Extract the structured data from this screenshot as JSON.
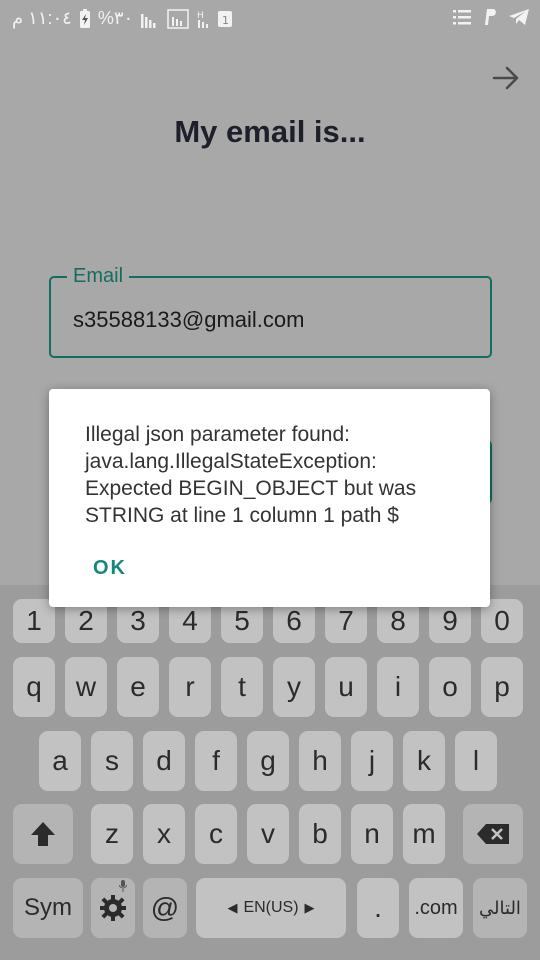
{
  "status_bar": {
    "time": "١١:٠٤ م",
    "battery": "%٣٠",
    "left_icons": [
      "battery-icon",
      "signal-icon",
      "signal-box-icon",
      "hplus-icon",
      "sim-icon"
    ],
    "sim_label": "1",
    "right_icons": [
      "list-icon",
      "paypal-icon",
      "telegram-icon"
    ]
  },
  "page": {
    "title": "My email is...",
    "email_label": "Email",
    "email_value": "s35588133@gmail.com"
  },
  "dialog": {
    "message": "Illegal json parameter found: java.lang.IllegalStateException: Expected BEGIN_OBJECT but was STRING at line 1 column 1 path $",
    "ok_label": "OK"
  },
  "keyboard": {
    "numbers": [
      "1",
      "2",
      "3",
      "4",
      "5",
      "6",
      "7",
      "8",
      "9",
      "0"
    ],
    "row1": [
      "q",
      "w",
      "e",
      "r",
      "t",
      "y",
      "u",
      "i",
      "o",
      "p"
    ],
    "row2": [
      "a",
      "s",
      "d",
      "f",
      "g",
      "h",
      "j",
      "k",
      "l"
    ],
    "row3": [
      "z",
      "x",
      "c",
      "v",
      "b",
      "n",
      "m"
    ],
    "sym": "Sym",
    "at": "@",
    "space": "EN(US)",
    "dot": ".",
    "com": ".com",
    "enter": "التالي"
  }
}
